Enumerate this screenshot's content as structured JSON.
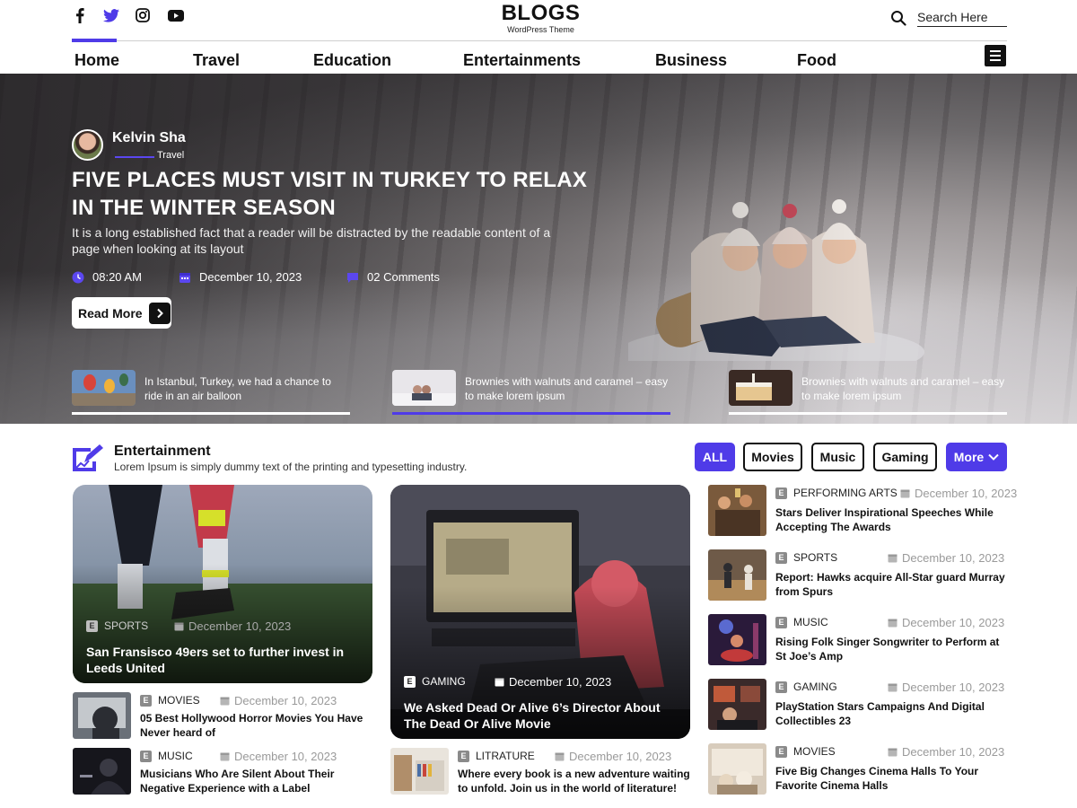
{
  "header": {
    "social_icons": [
      "facebook-icon",
      "twitter-icon",
      "instagram-icon",
      "youtube-icon"
    ],
    "logo_title": "BLOGS",
    "logo_subtitle": "WordPress Theme",
    "search_placeholder": "Search Here",
    "nav": [
      "Home",
      "Travel",
      "Education",
      "Entertainments",
      "Business",
      "Food"
    ],
    "accent": "#4f3be8"
  },
  "hero": {
    "author_name": "Kelvin Sha",
    "author_category": "Travel",
    "title_line1": "FIVE PLACES MUST VISIT IN TURKEY TO RELAX",
    "title_line2": "IN THE WINTER SEASON",
    "description": "It is a long established fact that a reader will be distracted by the readable content of a page when looking at its layout",
    "time": "08:20 AM",
    "date": "December 10, 2023",
    "comments": "02 Comments",
    "read_more": "Read More",
    "slides": [
      {
        "text": "In Istanbul, Turkey, we had a chance to ride in an air balloon",
        "active": false
      },
      {
        "text": "Brownies with walnuts and caramel – easy to make lorem ipsum",
        "active": true
      },
      {
        "text": "Brownies with walnuts and caramel – easy to make lorem ipsum",
        "active": false
      }
    ]
  },
  "section": {
    "title": "Entertainment",
    "subtitle": "Lorem Ipsum is simply dummy text of the printing and typesetting industry.",
    "filters": [
      "ALL",
      "Movies",
      "Music",
      "Gaming",
      "More"
    ],
    "active_filter": "ALL"
  },
  "featured": [
    {
      "category": "SPORTS",
      "date": "December 10, 2023",
      "title_line1": "San Fransisco 49ers set to further invest in",
      "title_line2": "Leeds United"
    },
    {
      "category": "GAMING",
      "date": "December 10, 2023",
      "title_line1": "We Asked Dead Or Alive 6’s Director About",
      "title_line2": "The Dead Or Alive Movie"
    }
  ],
  "left_list": [
    {
      "category": "MOVIES",
      "date": "December 10, 2023",
      "title_line1": "05 Best Hollywood Horror Movies You Have",
      "title_line2": "Never heard of"
    },
    {
      "category": "MUSIC",
      "date": "December 10, 2023",
      "title_line1": "Musicians Who Are Silent About Their",
      "title_line2": "Negative Experience with a Label"
    }
  ],
  "middle_list": [
    {
      "category": "LITRATURE",
      "date": "December 10, 2023",
      "title_line1": "Where every book is a new adventure waiting",
      "title_line2": "to unfold. Join us in the world of literature!"
    }
  ],
  "right_list": [
    {
      "category": "PERFORMING ARTS",
      "date": "December 10, 2023",
      "title_line1": "Stars Deliver Inspirational Speeches While",
      "title_line2": "Accepting The Awards"
    },
    {
      "category": "SPORTS",
      "date": "December 10, 2023",
      "title_line1": "Report: Hawks acquire All-Star guard Murray",
      "title_line2": "from Spurs"
    },
    {
      "category": "MUSIC",
      "date": "December 10, 2023",
      "title_line1": "Rising Folk Singer Songwriter to Perform at",
      "title_line2": "St Joe’s Amp"
    },
    {
      "category": "GAMING",
      "date": "December 10, 2023",
      "title_line1": "PlayStation Stars Campaigns And Digital",
      "title_line2": "Collectibles 23"
    },
    {
      "category": "MOVIES",
      "date": "December 10, 2023",
      "title_line1": "Five Big Changes Cinema Halls To Your",
      "title_line2": "Favorite Cinema Halls"
    }
  ]
}
